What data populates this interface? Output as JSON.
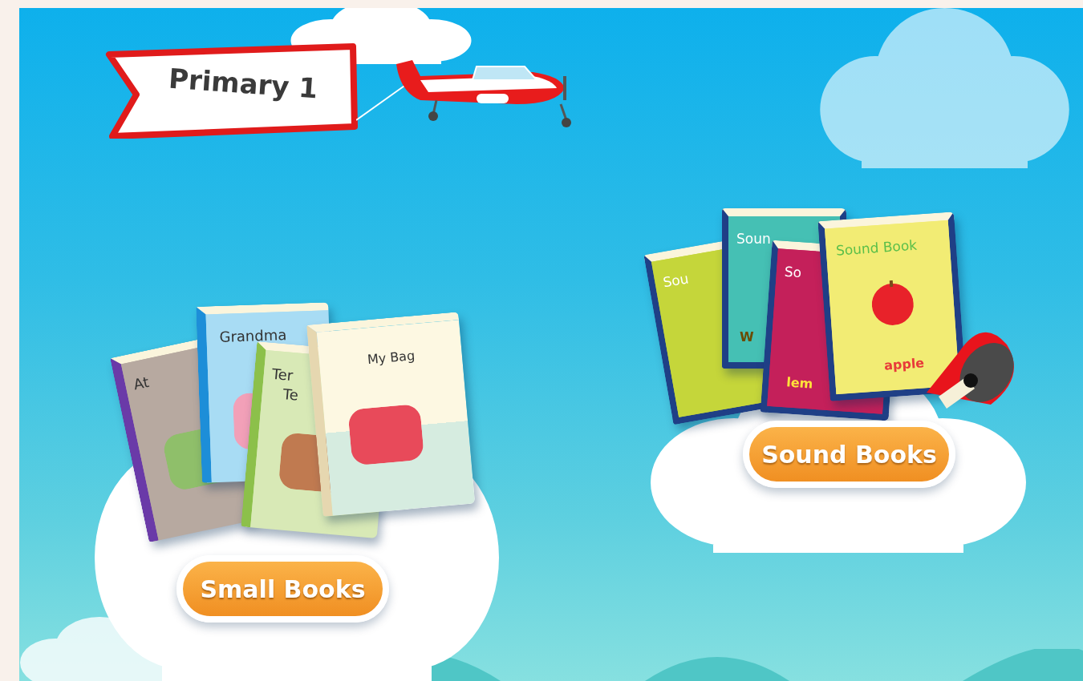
{
  "banner": {
    "title": "Primary 1"
  },
  "shelves": [
    {
      "kind": "small",
      "books": [
        {
          "title": "At"
        },
        {
          "title": "Grandma"
        },
        {
          "title": "Ter",
          "subtitle": "Te"
        },
        {
          "title": "My Bag"
        }
      ],
      "button": "Small Books"
    },
    {
      "kind": "sound",
      "books": [
        {
          "title": "Sou"
        },
        {
          "title": "Soun",
          "word": "W"
        },
        {
          "title": "So",
          "word": "lem"
        },
        {
          "title": "Sound Book",
          "word": "apple"
        }
      ],
      "button": "Sound Books"
    }
  ]
}
